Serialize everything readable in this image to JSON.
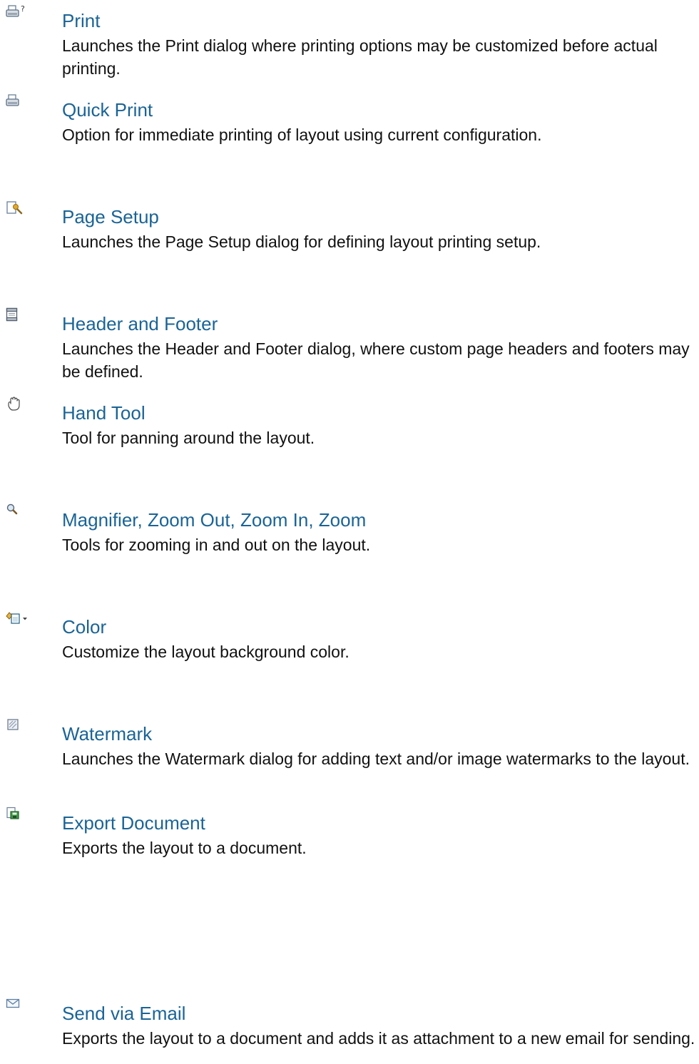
{
  "entries": [
    {
      "icon": "printer-options-icon",
      "title": "Print",
      "description": "Launches the Print dialog where printing options may be customized before actual printing."
    },
    {
      "icon": "printer-icon",
      "title": "Quick Print",
      "description": "Option for immediate printing of layout using current configuration."
    },
    {
      "icon": "page-setup-icon",
      "title": "Page Setup",
      "description": "Launches the Page Setup dialog for defining layout printing setup."
    },
    {
      "icon": "header-footer-icon",
      "title": "Header and Footer",
      "description": "Launches the Header and Footer dialog, where custom page headers and footers may be defined."
    },
    {
      "icon": "hand-icon",
      "title": "Hand Tool",
      "description": "Tool for panning around the layout."
    },
    {
      "icon": "magnifier-icon",
      "title": "Magnifier, Zoom Out, Zoom In, Zoom",
      "description": "Tools for zooming in and out on the layout."
    },
    {
      "icon": "paint-bucket-dropdown-icon",
      "title": "Color",
      "description": "Customize the layout background color."
    },
    {
      "icon": "watermark-icon",
      "title": "Watermark",
      "description": "Launches the Watermark dialog for adding text and/or image watermarks to the layout."
    },
    {
      "icon": "export-document-icon",
      "title": "Export Document",
      "description": "Exports the layout to a document."
    },
    {
      "icon": "envelope-icon",
      "title": "Send via Email",
      "description": "Exports the layout to a document and adds it as attachment to a new email for sending."
    }
  ]
}
